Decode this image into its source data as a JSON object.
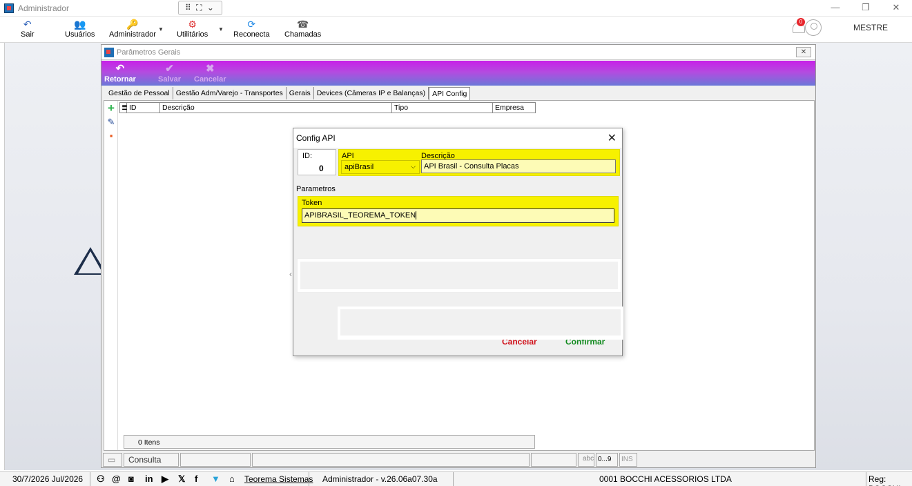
{
  "window": {
    "title": "Administrador",
    "snap_label": "⠿ ⛶ ⌄"
  },
  "toolbar": {
    "items": [
      {
        "label": "Sair",
        "icon": "↶"
      },
      {
        "label": "Usuários",
        "icon": "👥"
      },
      {
        "label": "Administrador",
        "icon": "🔑"
      },
      {
        "label": "Utilitários",
        "icon": "⚙"
      },
      {
        "label": "Reconecta",
        "icon": "⟳"
      },
      {
        "label": "Chamadas",
        "icon": "☎"
      }
    ],
    "notification_count": "0",
    "user": "MESTRE"
  },
  "child": {
    "title": "Parâmetros Gerais",
    "ribbon": {
      "back": "Retornar",
      "save": "Salvar",
      "cancel": "Cancelar"
    },
    "tabs": [
      "Gestão de Pessoal",
      "Gestão Adm/Varejo - Transportes",
      "Gerais",
      "Devices (Câmeras IP e Balanças)",
      "API Config"
    ],
    "grid": {
      "columns": [
        "ID",
        "Descrição",
        "Tipo",
        "Empresa"
      ]
    },
    "items_count": "0 Itens",
    "status": {
      "mode": "Consulta",
      "abc": "abc",
      "num": "0...9",
      "ins": "INS"
    }
  },
  "dialog": {
    "title": "Config API",
    "id_label": "ID:",
    "id_value": "0",
    "api_label": "API",
    "api_value": "apiBrasil",
    "descricao_label": "Descrição",
    "descricao_value": "API Brasil - Consulta Placas",
    "parametros_label": "Parametros",
    "token_label": "Token",
    "token_value": "APIBRASIL_TEOREMA_TOKEN",
    "cancel": "Cancelar",
    "confirm": "Confirmar"
  },
  "statusbar": {
    "date": "30/7/2026 Jul/2026",
    "company_link": "Teorema Sistemas",
    "version": "Administrador - v.26.06a07.30a",
    "company": "0001 BOCCHI ACESSORIOS LTDA",
    "reg": "Reg: BOCCHI"
  },
  "colors": {
    "ribbon": "#c821e8",
    "highlight": "#f7f100",
    "cancel": "#d0101a",
    "confirm": "#118a1e"
  }
}
